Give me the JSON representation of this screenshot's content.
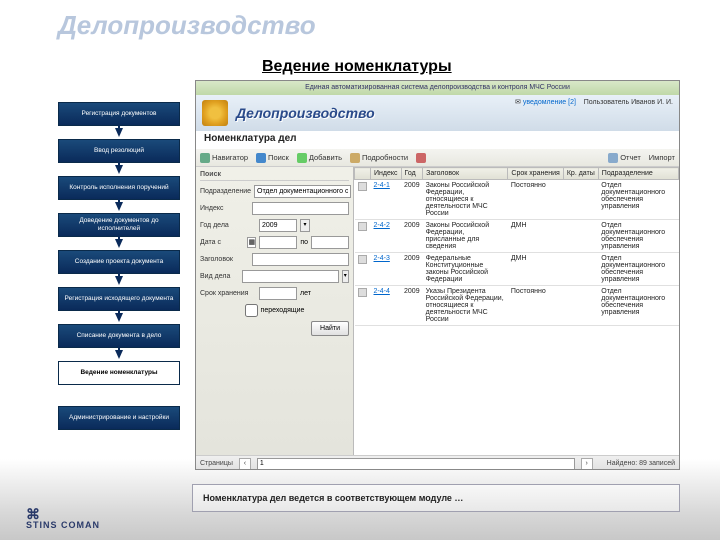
{
  "slide": {
    "title": "Делопроизводство",
    "section": "Ведение номенклатуры",
    "caption": "Номенклатура дел ведется в соответствующем модуле …",
    "footer_logo": "STINS  COMAN"
  },
  "nav": {
    "items": [
      {
        "label": "Регистрация документов"
      },
      {
        "label": "Ввод резолюций"
      },
      {
        "label": "Контроль исполнения поручений"
      },
      {
        "label": "Доведение документов до исполнителей"
      },
      {
        "label": "Создание проекта документа"
      },
      {
        "label": "Регистрация исходящего документа"
      },
      {
        "label": "Списание документа в дело"
      },
      {
        "label": "Ведение номенклатуры",
        "active": true
      },
      {
        "label": "Администрирование и настройки"
      }
    ]
  },
  "app": {
    "system_title": "Единая автоматизированная система делопроизводства и контроля МЧС России",
    "user_label": "Пользователь",
    "user_name": "Иванов И. И.",
    "logo_text": "Делопроизводство",
    "notif_label": "уведомление",
    "notif_count": "[2]",
    "page_title": "Номенклатура дел"
  },
  "toolbar": {
    "navigator": "Навигатор",
    "search": "Поиск",
    "add": "Добавить",
    "details": "Подробности",
    "delete": "",
    "report": "Отчет",
    "import": "Импорт"
  },
  "search": {
    "panel_title": "Поиск",
    "dept_label": "Подразделение",
    "dept_value": "Отдел документационного обе",
    "index_label": "Индекс",
    "year_label": "Год дела",
    "year_value": "2009",
    "datefrom_label": "Дата с",
    "dateto_label": "по",
    "title_label": "Заголовок",
    "type_label": "Вид дела",
    "term_label": "Срок хранения",
    "term_unit": "лет",
    "transitional": "переходящие",
    "find_btn": "Найти"
  },
  "grid": {
    "headers": {
      "index": "Индекс",
      "year": "Год",
      "title": "Заголовок",
      "term": "Срок хранения",
      "dates": "Кр. даты",
      "dept": "Подразделение"
    },
    "rows": [
      {
        "index": "2-4-1",
        "year": "2009",
        "title": "Законы Российской Федерации, относящиеся к деятельности МЧС России",
        "term": "Постоянно",
        "dates": "",
        "dept": "Отдел документационного обеспечения управления"
      },
      {
        "index": "2-4-2",
        "year": "2009",
        "title": "Законы Российской Федерации, присланные для сведения",
        "term": "ДМН",
        "dates": "",
        "dept": "Отдел документационного обеспечения управления"
      },
      {
        "index": "2-4-3",
        "year": "2009",
        "title": "Федеральные Конституционные законы Российской Федерации",
        "term": "ДМН",
        "dates": "",
        "dept": "Отдел документационного обеспечения управления"
      },
      {
        "index": "2-4-4",
        "year": "2009",
        "title": "Указы Президента Российской Федерации, относящиеся к деятельности МЧС России",
        "term": "Постоянно",
        "dates": "",
        "dept": "Отдел документационного обеспечения управления"
      }
    ]
  },
  "status": {
    "pages_label": "Страницы",
    "page_current": "1",
    "found_label": "Найдено: 89 записей"
  }
}
